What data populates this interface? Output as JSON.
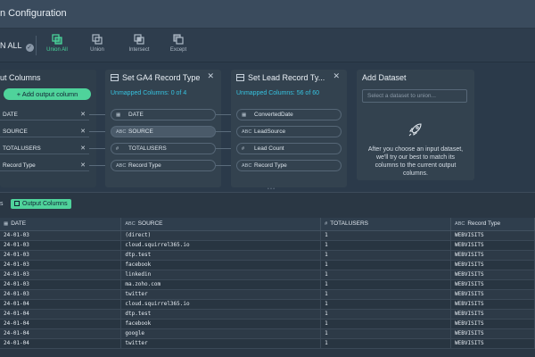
{
  "window": {
    "title": "n Configuration"
  },
  "toolbar": {
    "run_all": "N ALL",
    "tools": [
      {
        "label": "Union All",
        "icon": "union-all-icon",
        "active": true
      },
      {
        "label": "Union",
        "icon": "union-icon",
        "active": false
      },
      {
        "label": "Intersect",
        "icon": "intersect-icon",
        "active": false
      },
      {
        "label": "Except",
        "icon": "except-icon",
        "active": false
      }
    ]
  },
  "output_columns": {
    "title": "ut Columns",
    "add_button": "+ Add output column",
    "items": [
      "DATE",
      "SOURCE",
      "TOTALUSERS",
      "Record Type"
    ]
  },
  "ga4": {
    "title": "Set GA4 Record Type",
    "unmapped": "Unmapped Columns: 0 of 4",
    "fields": [
      {
        "type": "cal",
        "name": "DATE"
      },
      {
        "type": "ABC",
        "name": "SOURCE"
      },
      {
        "type": "#",
        "name": "TOTALUSERS"
      },
      {
        "type": "ABC",
        "name": "Record Type"
      }
    ]
  },
  "lead": {
    "title": "Set Lead Record Ty...",
    "unmapped": "Unmapped Columns: 56 of 60",
    "fields": [
      {
        "type": "cal",
        "name": "ConvertedDate"
      },
      {
        "type": "ABC",
        "name": "LeadSource"
      },
      {
        "type": "#",
        "name": "Lead Count"
      },
      {
        "type": "ABC",
        "name": "Record Type"
      }
    ]
  },
  "add_dataset": {
    "title": "Add Dataset",
    "placeholder": "Select a dataset to union...",
    "description": "After you choose an input dataset, we'll try our best to match its columns to the current output columns."
  },
  "results": {
    "side": "s",
    "tag": "Output Columns",
    "headers": [
      "DATE",
      "SOURCE",
      "TOTALUSERS",
      "Record Type"
    ],
    "header_types": [
      "cal",
      "ABC",
      "#",
      "ABC"
    ],
    "rows": [
      [
        "24-01-03",
        "(direct)",
        "1",
        "WEBVISITS"
      ],
      [
        "24-01-03",
        "cloud.squirrel365.io",
        "1",
        "WEBVISITS"
      ],
      [
        "24-01-03",
        "dtp.test",
        "1",
        "WEBVISITS"
      ],
      [
        "24-01-03",
        "facebook",
        "1",
        "WEBVISITS"
      ],
      [
        "24-01-03",
        "linkedin",
        "1",
        "WEBVISITS"
      ],
      [
        "24-01-03",
        "ma.zoho.com",
        "1",
        "WEBVISITS"
      ],
      [
        "24-01-03",
        "twitter",
        "1",
        "WEBVISITS"
      ],
      [
        "24-01-04",
        "cloud.squirrel365.io",
        "1",
        "WEBVISITS"
      ],
      [
        "24-01-04",
        "dtp.test",
        "1",
        "WEBVISITS"
      ],
      [
        "24-01-04",
        "facebook",
        "1",
        "WEBVISITS"
      ],
      [
        "24-01-04",
        "google",
        "1",
        "WEBVISITS"
      ],
      [
        "24-01-04",
        "twitter",
        "1",
        "WEBVISITS"
      ]
    ]
  },
  "colors": {
    "accent": "#4fd39b",
    "link": "#36c3e0",
    "bg": "#2b3a4a"
  }
}
